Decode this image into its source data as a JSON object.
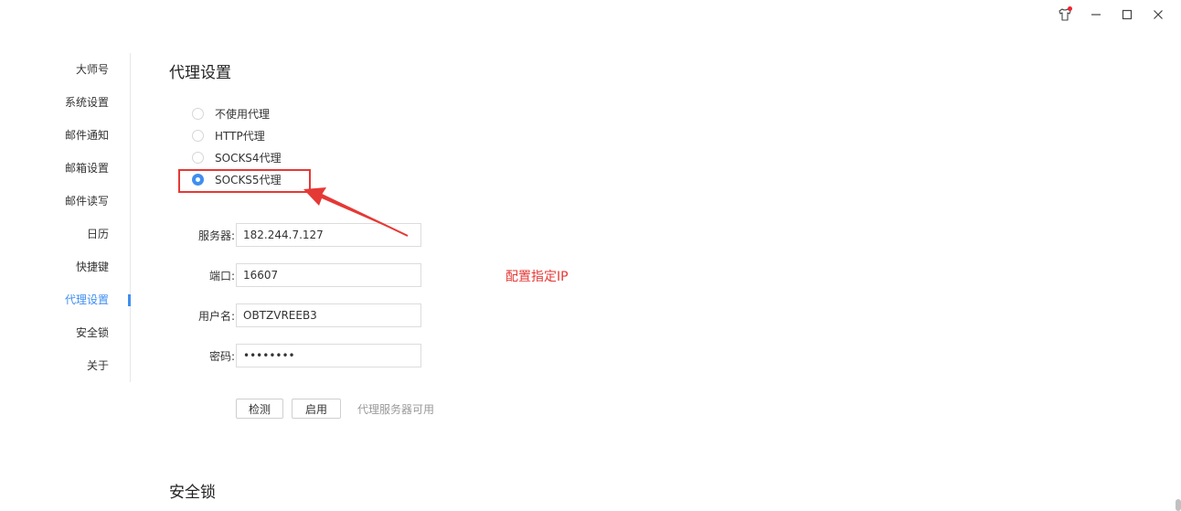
{
  "sidebar": {
    "items": [
      {
        "label": "大师号"
      },
      {
        "label": "系统设置"
      },
      {
        "label": "邮件通知"
      },
      {
        "label": "邮箱设置"
      },
      {
        "label": "邮件读写"
      },
      {
        "label": "日历"
      },
      {
        "label": "快捷键"
      },
      {
        "label": "代理设置",
        "active": true
      },
      {
        "label": "安全锁"
      },
      {
        "label": "关于"
      }
    ]
  },
  "proxy": {
    "title": "代理设置",
    "options": [
      {
        "label": "不使用代理",
        "checked": false
      },
      {
        "label": "HTTP代理",
        "checked": false
      },
      {
        "label": "SOCKS4代理",
        "checked": false
      },
      {
        "label": "SOCKS5代理",
        "checked": true
      }
    ],
    "server_label": "服务器:",
    "server_value": "182.244.7.127",
    "port_label": "端口:",
    "port_value": "16607",
    "username_label": "用户名:",
    "username_value": "OBTZVREEB3",
    "password_label": "密码:",
    "password_value": "••••••••",
    "detect_button": "检测",
    "enable_button": "启用",
    "status": "代理服务器可用"
  },
  "security": {
    "title": "安全锁"
  },
  "annotation": {
    "text": "配置指定IP",
    "color": "#e53935"
  },
  "colors": {
    "accent": "#3f8ef0",
    "annotation_red": "#e53935"
  },
  "icons": [
    "skin-icon",
    "minimize-icon",
    "maximize-icon",
    "close-icon"
  ]
}
